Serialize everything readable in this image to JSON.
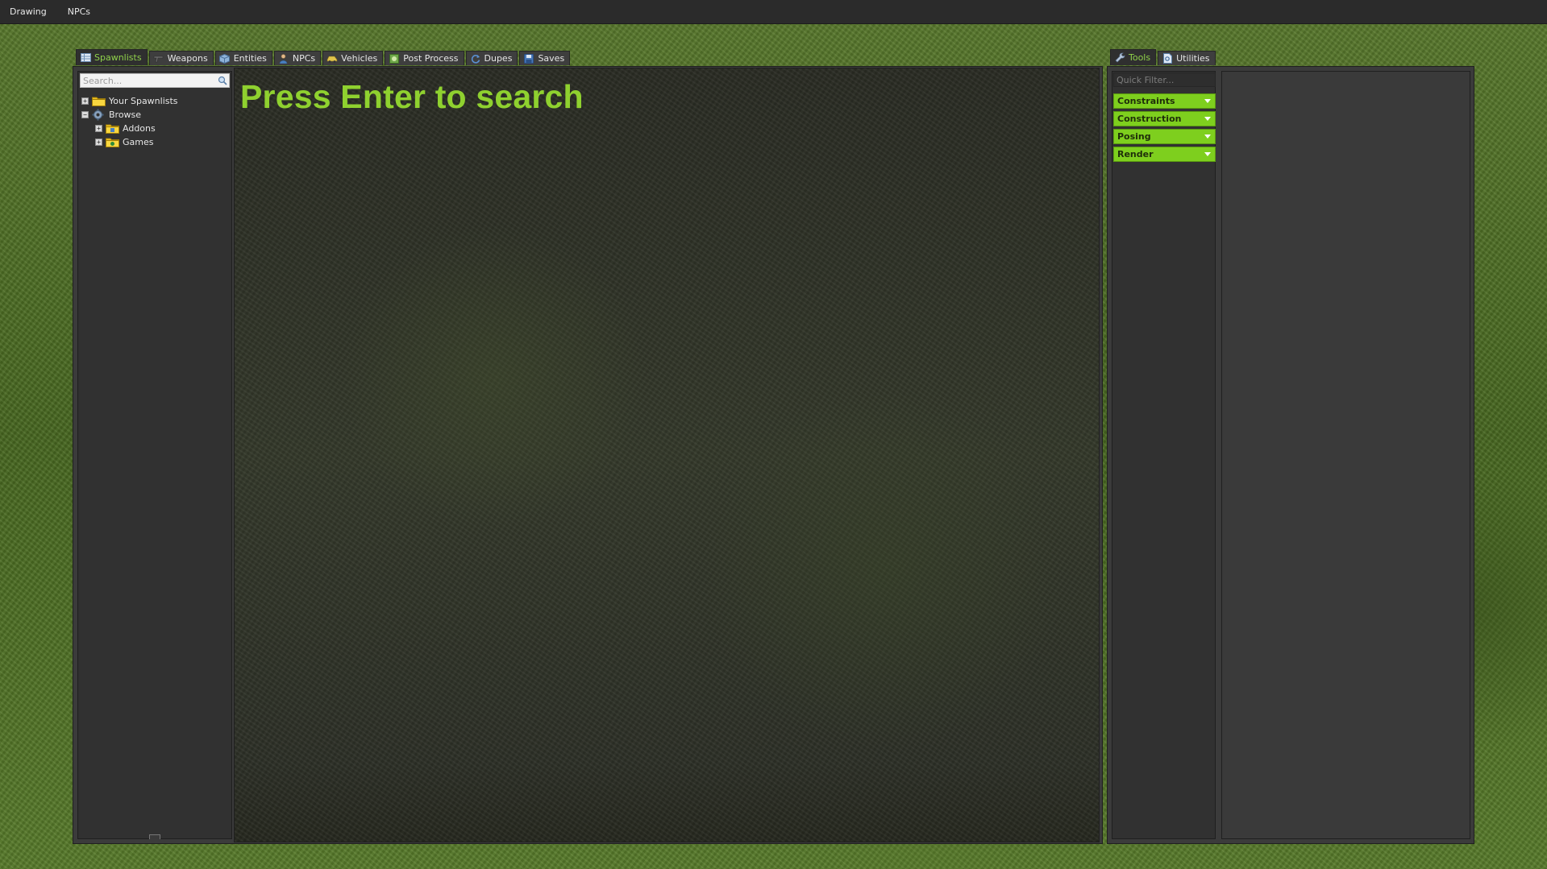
{
  "menubar": {
    "items": [
      "Drawing",
      "NPCs"
    ]
  },
  "spawnmenu": {
    "tabs": [
      {
        "label": "Spawnlists",
        "icon": "grid-icon"
      },
      {
        "label": "Weapons",
        "icon": "gun-icon"
      },
      {
        "label": "Entities",
        "icon": "cube-icon"
      },
      {
        "label": "NPCs",
        "icon": "person-icon"
      },
      {
        "label": "Vehicles",
        "icon": "car-icon"
      },
      {
        "label": "Post Process",
        "icon": "filter-icon"
      },
      {
        "label": "Dupes",
        "icon": "refresh-icon"
      },
      {
        "label": "Saves",
        "icon": "disk-icon"
      }
    ],
    "active_tab": "Spawnlists",
    "search": {
      "placeholder": "Search...",
      "value": ""
    },
    "tree": {
      "your_spawnlists": "Your Spawnlists",
      "browse": "Browse",
      "addons": "Addons",
      "games": "Games"
    },
    "hint": "Press Enter to search"
  },
  "toolmenu": {
    "tabs": [
      {
        "label": "Tools",
        "icon": "wrench-icon"
      },
      {
        "label": "Utilities",
        "icon": "page-icon"
      }
    ],
    "active_tab": "Tools",
    "filter": {
      "placeholder": "Quick Filter...",
      "value": ""
    },
    "categories": [
      "Constraints",
      "Construction",
      "Posing",
      "Render"
    ]
  },
  "colors": {
    "accent_green": "#8fd12f",
    "category_green": "#7ecf1e",
    "panel_dark": "#313131",
    "menubar": "#2b2b2b"
  }
}
